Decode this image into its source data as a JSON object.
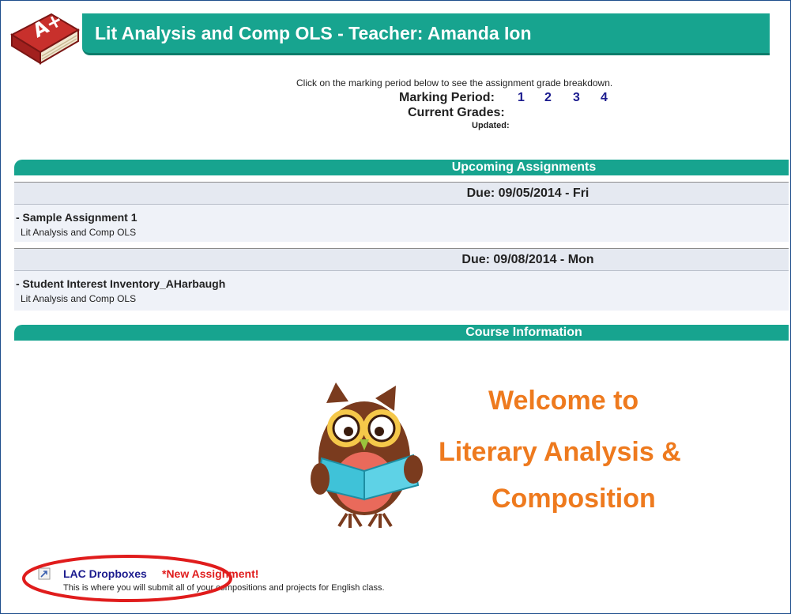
{
  "header": {
    "title": "Lit Analysis and Comp OLS - Teacher: Amanda Ion",
    "logo_icon": "book-a-plus-icon",
    "bar_color": "#17a48f"
  },
  "marking": {
    "instructions": "Click on the marking period below to see the assignment grade breakdown.",
    "period_label": "Marking Period:",
    "periods": [
      "1",
      "2",
      "3",
      "4"
    ],
    "current_grades_label": "Current Grades:",
    "updated_label": "Updated:"
  },
  "upcoming": {
    "title": "Upcoming Assignments",
    "groups": [
      {
        "due": "Due: 09/05/2014 - Fri",
        "items": [
          {
            "title": "- Sample Assignment 1",
            "course": "Lit Analysis and Comp OLS"
          }
        ]
      },
      {
        "due": "Due: 09/08/2014 - Mon",
        "items": [
          {
            "title": "- Student Interest Inventory_AHarbaugh",
            "course": "Lit Analysis and Comp OLS"
          }
        ]
      }
    ]
  },
  "course_info": {
    "title": "Course Information",
    "welcome_lines": [
      "Welcome to",
      "Literary Analysis &",
      "Composition"
    ],
    "welcome_color": "#ee7a1e",
    "owl_icon": "owl-reading-icon",
    "dropbox": {
      "icon": "link-icon",
      "label": "LAC Dropboxes",
      "badge": "*New Assignment!",
      "description": "This is where you will submit all of your compositions and projects for English class."
    }
  }
}
